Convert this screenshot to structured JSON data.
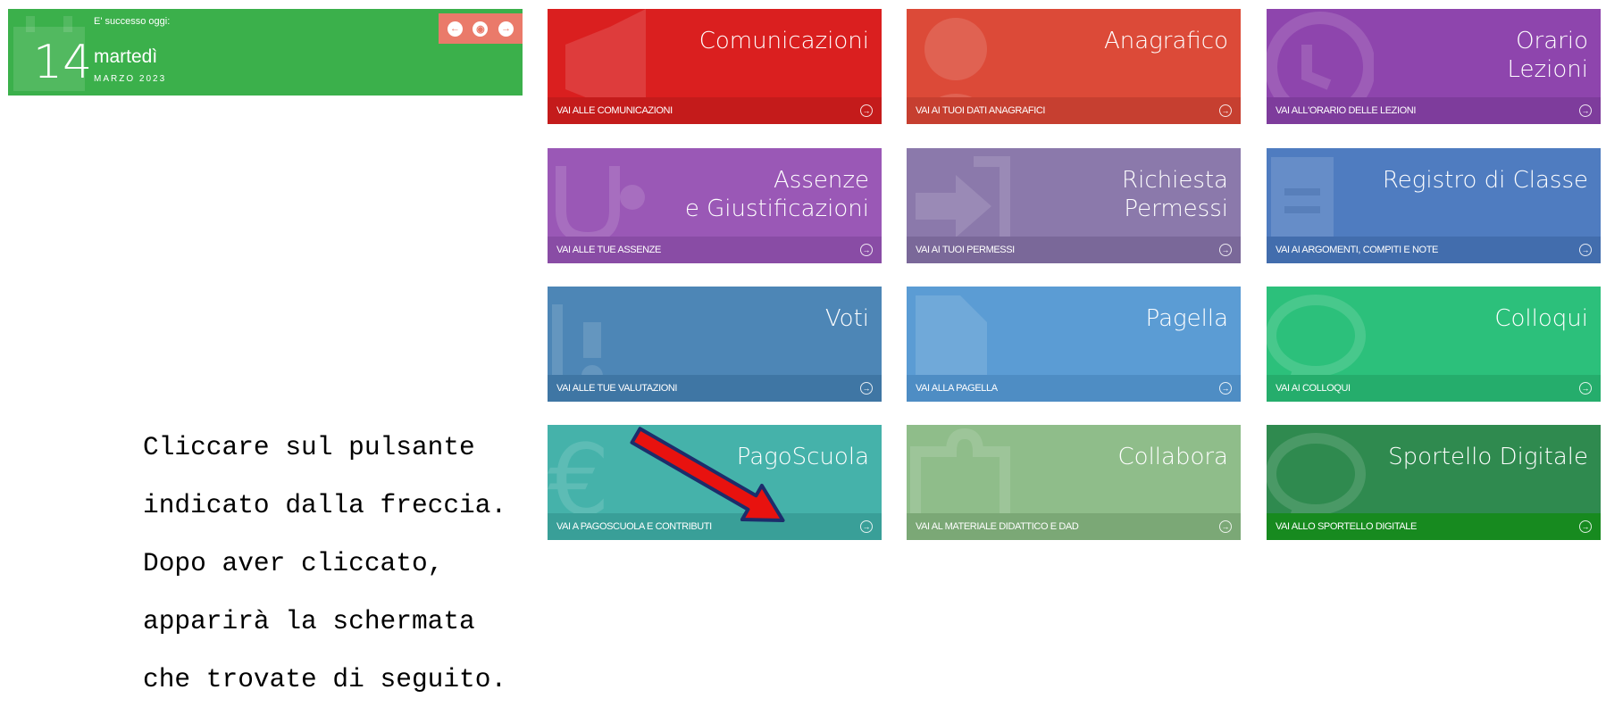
{
  "date_widget": {
    "happened_label": "E' successo oggi:",
    "day": "14",
    "weekday": "martedì",
    "month_year": "MARZO 2023",
    "nav": [
      "prev-icon",
      "target-icon",
      "next-icon"
    ]
  },
  "tiles": [
    {
      "title": "Comunicazioni",
      "link": "VAI ALLE COMUNICAZIONI",
      "color": "#da1f1f",
      "bar": "#c41b1b",
      "icon": "megaphone-icon"
    },
    {
      "title": "Anagrafico",
      "link": "VAI AI TUOI DATI ANAGRAFICI",
      "color": "#dc4a38",
      "bar": "#c63f30",
      "icon": "user-icon"
    },
    {
      "title_lines": [
        "Orario",
        "Lezioni"
      ],
      "link": "VAI ALL'ORARIO DELLE LEZIONI",
      "color": "#8e45ad",
      "bar": "#7e3c9c",
      "icon": "clock-icon"
    },
    {
      "title_lines": [
        "Assenze",
        "e Giustificazioni"
      ],
      "link": "VAI ALLE TUE ASSENZE",
      "color": "#9a58b6",
      "bar": "#894ca5",
      "icon": "stethoscope-icon"
    },
    {
      "title_lines": [
        "Richiesta",
        "Permessi"
      ],
      "link": "VAI AI TUOI PERMESSI",
      "color": "#8b79ab",
      "bar": "#7a6899",
      "icon": "exit-icon"
    },
    {
      "title": "Registro di Classe",
      "link": "VAI AI ARGOMENTI, COMPITI E NOTE",
      "color": "#4f7cc0",
      "bar": "#426dad",
      "icon": "notebook-icon"
    },
    {
      "title": "Voti",
      "link": "VAI ALLE TUE VALUTAZIONI",
      "color": "#4d86b6",
      "bar": "#3f76a4",
      "icon": "grades-icon"
    },
    {
      "title": "Pagella",
      "link": "VAI ALLA PAGELLA",
      "color": "#5b9cd4",
      "bar": "#4e8dc4",
      "icon": "document-icon"
    },
    {
      "title": "Colloqui",
      "link": "VAI AI COLLOQUI",
      "color": "#2cc07b",
      "bar": "#25ad6c",
      "icon": "chat-icon"
    },
    {
      "title": "PagoScuola",
      "link": "VAI A PAGOSCUOLA E CONTRIBUTI",
      "color": "#45b2aa",
      "bar": "#399f98",
      "icon": "euro-icon"
    },
    {
      "title": "Collabora",
      "link": "VAI AL MATERIALE DIDATTICO E DAD",
      "color": "#8fbd8a",
      "bar": "#7ba876",
      "icon": "puzzle-icon"
    },
    {
      "title": "Sportello Digitale",
      "link": "VAI ALLO SPORTELLO DIGITALE",
      "color": "#2f8a4f",
      "bar": "#178a1f",
      "icon": "chat-icon"
    }
  ],
  "instruction": {
    "lines": [
      "Cliccare sul pulsante",
      "indicato dalla freccia.",
      "Dopo aver cliccato,",
      "apparirà la schermata",
      "che trovate di seguito."
    ]
  },
  "pointer": {
    "icon": "red-arrow-icon",
    "color": "#e8120f"
  }
}
